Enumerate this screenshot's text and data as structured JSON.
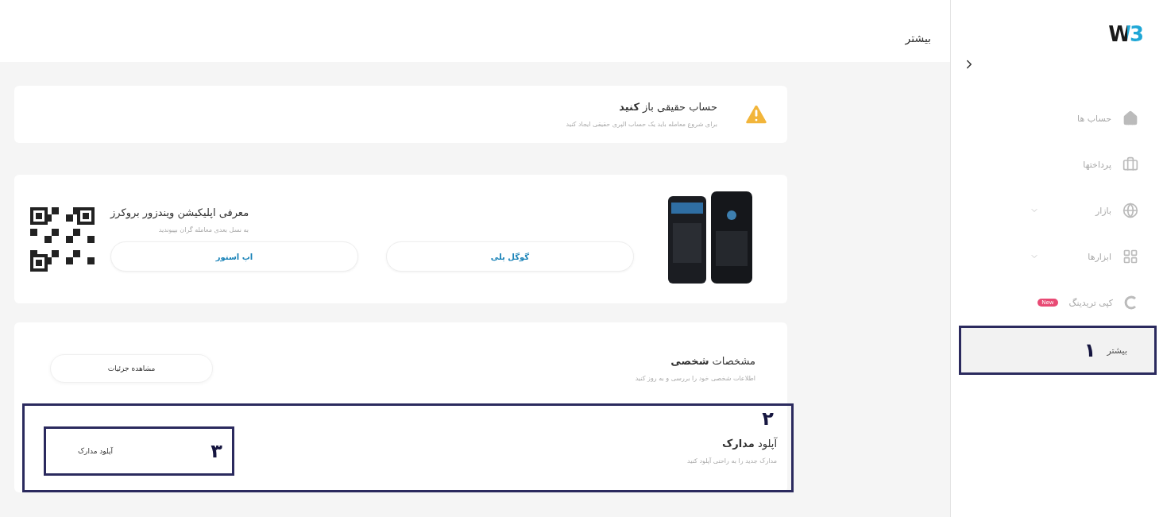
{
  "sidebar": {
    "logo": "W3",
    "items": [
      {
        "label": "حساب ها",
        "selected": false
      },
      {
        "label": "پرداختها",
        "selected": false
      },
      {
        "label": "بازار",
        "selected": false,
        "expanded": false
      },
      {
        "label": "ابزارها",
        "selected": false,
        "expanded": false
      },
      {
        "label": "کپی تریدینگ",
        "selected": false,
        "badge": "New"
      },
      {
        "label": "بیشتر",
        "selected": true,
        "annotation": "۱"
      }
    ]
  },
  "page_title": "بیشتر",
  "alert": {
    "title": "حساب حقیقی باز **کنید**",
    "text": "برای شروع معامله باید یک حساب الپری حقیقی ایجاد کنید"
  },
  "app_promo": {
    "title": "معرفی اپلیکیشن ویندزور بروکرز",
    "text": "به نسل بعدی معامله گران بپیوندید",
    "buttons": [
      "گوگل پلی",
      "اپ استور"
    ]
  },
  "sections": [
    {
      "title": "مشخصات **شخصی**",
      "text": "اطلاعات شخصی خود را بررسی و به روز کنید",
      "button": "مشاهده جزئیات"
    },
    {
      "title": "آپلود **مدارک**",
      "text": "مدارک جدید را به راحتی آپلود کنید",
      "button": "آپلود مدارک",
      "annotation": "۲",
      "button_annotation": "۳"
    }
  ]
}
